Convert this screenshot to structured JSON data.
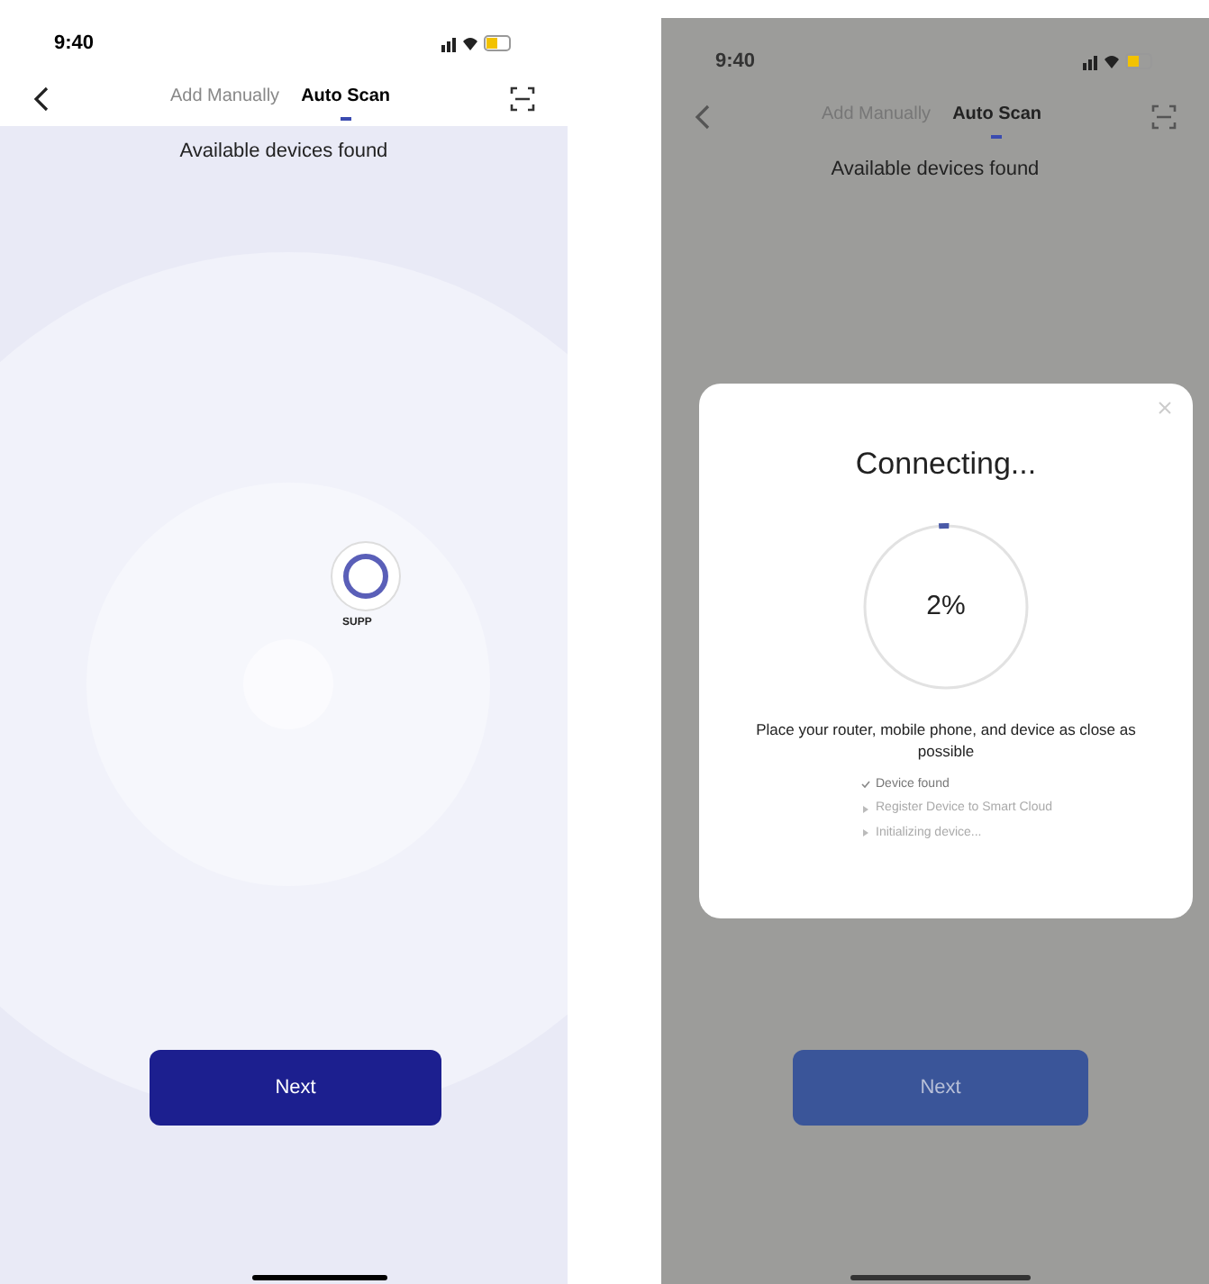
{
  "scan_screen": {
    "status_time": "9:40",
    "tabs": [
      {
        "label": "Add Manually",
        "selected": false
      },
      {
        "label": "Auto Scan",
        "selected": true
      }
    ],
    "heading": "Available devices found",
    "device_label": "SUPP",
    "button": "Next"
  },
  "connecting_screen": {
    "status_time": "9:40",
    "tabs": [
      {
        "label": "Add Manually",
        "selected": false
      },
      {
        "label": "Auto Scan",
        "selected": true
      }
    ],
    "heading": "Available devices found",
    "button": "Next",
    "dialog": {
      "title": "Connecting...",
      "progress": {
        "level": 0.02,
        "reading": "2%"
      },
      "message": "Place your router, mobile phone, and device as close as possible",
      "steps": [
        {
          "label": "Device found",
          "done": true
        },
        {
          "label": "Register Device to Smart Cloud",
          "done": false
        },
        {
          "label": "Initializing device...",
          "done": false
        }
      ]
    }
  }
}
